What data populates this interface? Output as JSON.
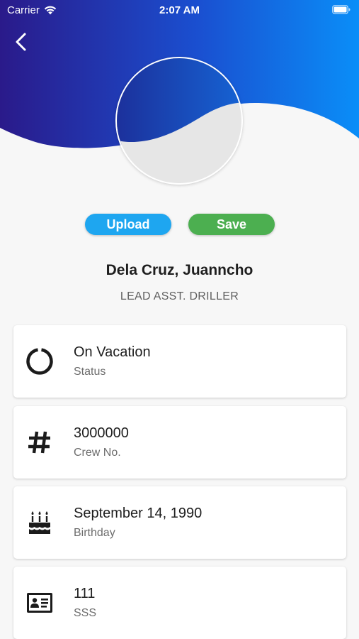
{
  "status_bar": {
    "carrier": "Carrier",
    "time": "2:07 AM"
  },
  "actions": {
    "upload_label": "Upload",
    "save_label": "Save"
  },
  "profile": {
    "name": "Dela Cruz, Juanncho",
    "role": "LEAD ASST. DRILLER"
  },
  "details": [
    {
      "value": "On Vacation",
      "label": "Status",
      "icon": "status-ring-icon"
    },
    {
      "value": "3000000",
      "label": "Crew No.",
      "icon": "hash-icon"
    },
    {
      "value": "September 14, 1990",
      "label": "Birthday",
      "icon": "birthday-cake-icon"
    },
    {
      "value": "111",
      "label": "SSS",
      "icon": "id-card-icon"
    }
  ],
  "colors": {
    "header_gradient_start": "#2a1a8a",
    "header_gradient_end": "#0a8ef8",
    "upload": "#1ea6f0",
    "save": "#4caf50"
  }
}
